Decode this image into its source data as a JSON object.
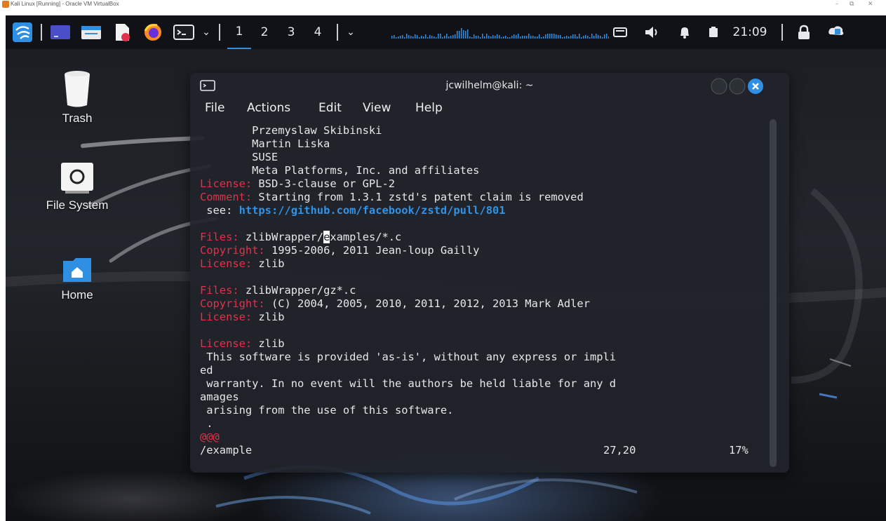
{
  "host_window": {
    "title": "Kali Linux [Running] - Oracle VM VirtualBox",
    "minimize": "–",
    "restore": "⧉",
    "close": "✕"
  },
  "panel": {
    "workspaces": [
      "1",
      "2",
      "3",
      "4"
    ],
    "active_workspace": "1",
    "clock": "21:09",
    "icons": [
      "kali-menu-icon",
      "show-desktop-icon",
      "file-manager-icon",
      "text-editor-icon",
      "firefox-icon",
      "terminal-icon",
      "chevron-down-icon",
      "chevron-down-icon",
      "network-activity-graph",
      "display-icon",
      "volume-icon",
      "notification-bell-icon",
      "battery-icon",
      "lock-icon",
      "update-notifier-icon"
    ]
  },
  "desktop": {
    "icons": [
      {
        "label": "Trash",
        "icon": "trash-icon"
      },
      {
        "label": "File System",
        "icon": "drive-icon"
      },
      {
        "label": "Home",
        "icon": "home-folder-icon"
      }
    ]
  },
  "terminal": {
    "title": "jcwilhelm@kali: ~",
    "menu": [
      "File",
      "Actions",
      "Edit",
      "View",
      "Help"
    ],
    "lines": [
      {
        "text": "        Przemyslaw Skibinski"
      },
      {
        "text": "        Martin Liska"
      },
      {
        "text": "        SUSE"
      },
      {
        "text": "        Meta Platforms, Inc. and affiliates"
      },
      {
        "key": "License:",
        "text": " BSD-3-clause or GPL-2"
      },
      {
        "key": "Comment:",
        "text": " Starting from 1.3.1 zstd's patent claim is removed"
      },
      {
        "text": " see: ",
        "url": "https://github.com/facebook/zstd/pull/801"
      },
      {
        "text": ""
      },
      {
        "key": "Files:",
        "text": " zlibWrapper/",
        "cursor": "e",
        "rest": "xamples/*.c"
      },
      {
        "key": "Copyright:",
        "text": " 1995-2006, 2011 Jean-loup Gailly"
      },
      {
        "key": "License:",
        "text": " zlib"
      },
      {
        "text": ""
      },
      {
        "key": "Files:",
        "text": " zlibWrapper/gz*.c"
      },
      {
        "key": "Copyright:",
        "text": " (C) 2004, 2005, 2010, 2011, 2012, 2013 Mark Adler"
      },
      {
        "key": "License:",
        "text": " zlib"
      },
      {
        "text": ""
      },
      {
        "key": "License:",
        "text": " zlib"
      },
      {
        "text": " This software is provided 'as-is', without any express or impli"
      },
      {
        "text": "ed"
      },
      {
        "text": " warranty. In no event will the authors be held liable for any d"
      },
      {
        "text": "amages"
      },
      {
        "text": " arising from the use of this software."
      },
      {
        "text": " ."
      },
      {
        "key": "@@@",
        "text": ""
      }
    ],
    "status": {
      "command": "/example",
      "position": "27,20",
      "percent": "17%"
    }
  },
  "colors": {
    "key": "#e0334b",
    "url": "#2f93ea",
    "accent": "#2f8fe3",
    "close_button": "#2f8fe3"
  }
}
